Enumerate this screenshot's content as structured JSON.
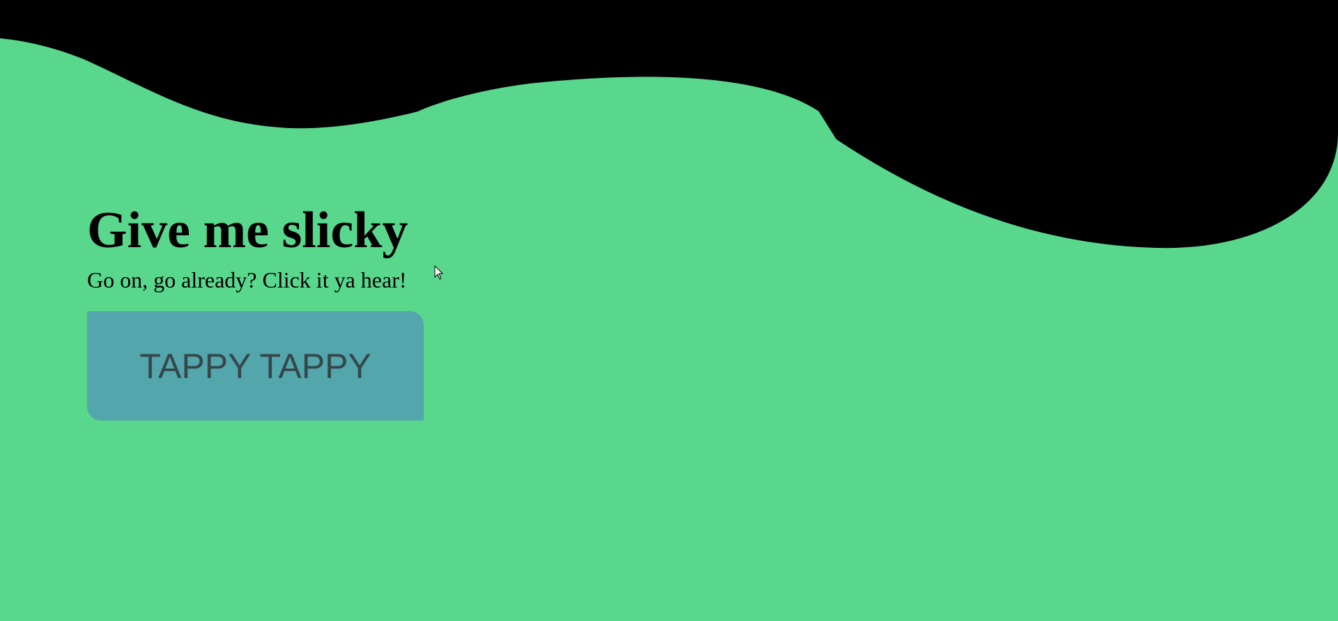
{
  "hero": {
    "title": "Give me slicky",
    "subtitle": "Go on, go already? Click it ya hear!",
    "button_label": "TAPPY TAPPY"
  },
  "colors": {
    "background": "#59d78d",
    "wave": "#000000",
    "button": "#52a6ac",
    "button_text": "#35474a"
  },
  "icons": {
    "cursor": "mouse-pointer-icon"
  }
}
